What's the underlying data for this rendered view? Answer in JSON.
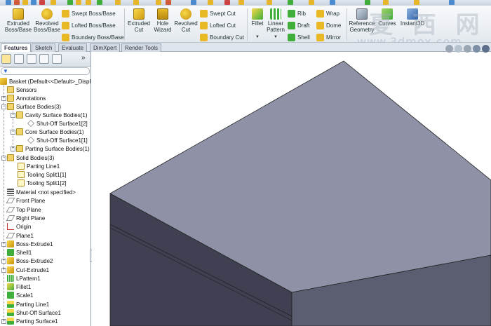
{
  "ribbon": {
    "extruded_boss": "Extruded\nBoss/Base",
    "revolved_boss": "Revolved\nBoss/Base",
    "swept_boss": "Swept Boss/Base",
    "lofted_boss": "Lofted Boss/Base",
    "boundary_boss": "Boundary Boss/Base",
    "extruded_cut": "Extruded\nCut",
    "hole_wizard": "Hole\nWizard",
    "revolved_cut": "Revolved\nCut",
    "swept_cut": "Swept Cut",
    "lofted_cut": "Lofted Cut",
    "boundary_cut": "Boundary Cut",
    "fillet": "Fillet",
    "linear_pattern": "Linear\nPattern",
    "rib": "Rib",
    "draft": "Draft",
    "shell": "Shell",
    "wrap": "Wrap",
    "dome": "Dome",
    "mirror": "Mirror",
    "reference_geometry": "Reference\nGeometry",
    "curves": "Curves",
    "instant3d": "Instant3D"
  },
  "watermark": {
    "chinese": "夏 西 网",
    "url": "www.3dmox.com"
  },
  "tabs": [
    "Features",
    "Sketch",
    "Evaluate",
    "DimXpert",
    "Render Tools"
  ],
  "tree": {
    "root": "Basket  (Default<<Default>_Displ",
    "sensors": "Sensors",
    "annotations": "Annotations",
    "surface_bodies": "Surface Bodies(3)",
    "cavity_surface_bodies": "Cavity Surface Bodies(1)",
    "shutoff_surface1_2": "Shut-Off Surface1[2]",
    "core_surface_bodies": "Core Surface Bodies(1)",
    "shutoff_surface1_1": "Shut-Off Surface1[1]",
    "parting_surface_bodies": "Parting Surface Bodies(1)",
    "solid_bodies": "Solid Bodies(3)",
    "parting_line1_body": "Parting Line1",
    "tooling_split1_1": "Tooling Split1[1]",
    "tooling_split1_2": "Tooling Split1[2]",
    "material": "Material <not specified>",
    "front_plane": "Front Plane",
    "top_plane": "Top Plane",
    "right_plane": "Right Plane",
    "origin": "Origin",
    "plane1": "Plane1",
    "boss_extrude1": "Boss-Extrude1",
    "shell1": "Shell1",
    "boss_extrude2": "Boss-Extrude2",
    "cut_extrude1": "Cut-Extrude1",
    "lpattern1": "LPattern1",
    "fillet1": "Fillet1",
    "scale1": "Scale1",
    "parting_line1": "Parting Line1",
    "shutoff_surface1": "Shut-Off Surface1",
    "parting_surface1": "Parting Surface1"
  },
  "colors": {
    "box_top": "#8f92a6",
    "box_side": "#5b5e70",
    "box_front": "#3f4152",
    "accent_yellow": "#f2c624",
    "accent_green": "#3fae3a"
  }
}
